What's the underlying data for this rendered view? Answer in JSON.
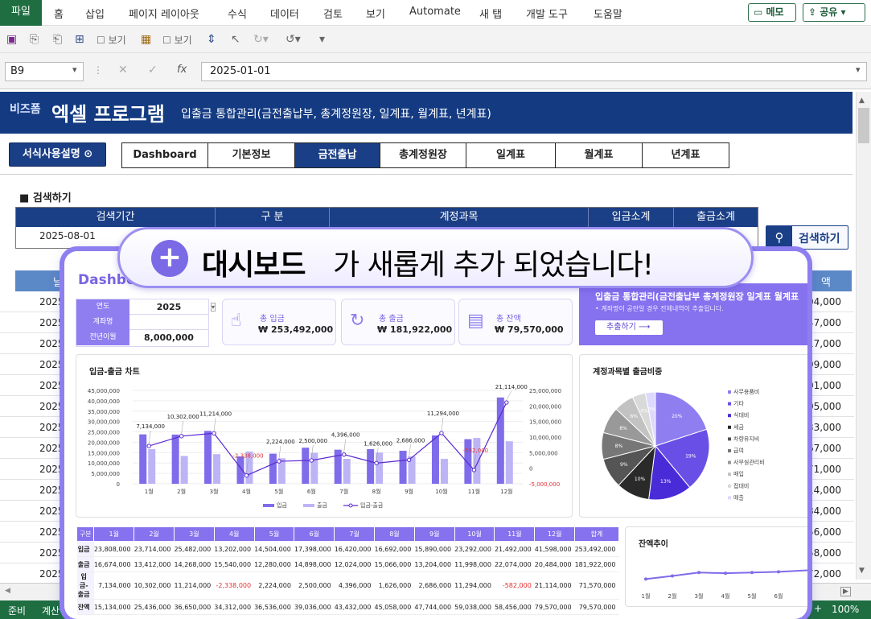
{
  "ribbon": {
    "file": "파일",
    "menus": [
      "홈",
      "삽입",
      "페이지 레이아웃",
      "수식",
      "데이터",
      "검토",
      "보기",
      "Automate",
      "새 탭",
      "개발 도구",
      "도움말"
    ],
    "memo": "메모",
    "share": "공유"
  },
  "qat": {
    "view1": "보기",
    "view2": "보기"
  },
  "formula": {
    "cell": "B9",
    "value": "2025-01-01",
    "fx": "fx"
  },
  "banner": {
    "brand_small": "비즈폼",
    "brand": "엑셀 프로그램",
    "subtitle": "입출금 통합관리(금전출납부, 총계정원장, 일계표, 월계표, 년계표)"
  },
  "guide_button": "서식사용설명",
  "nav_tabs": [
    "Dashboard",
    "기본정보",
    "금전출납",
    "총계정원장",
    "일계표",
    "월계표",
    "년계표"
  ],
  "nav_active": 2,
  "search": {
    "section": "검색하기",
    "period_label": "검색기간",
    "category_label": "구 분",
    "account_label": "계정과목",
    "income_label": "입금소계",
    "expense_label": "출금소계",
    "period_value": "2025-08-01",
    "button": "검색하기"
  },
  "ledger": {
    "date_header": "날",
    "amount_header": "액",
    "dates": [
      "2025",
      "2025",
      "2025",
      "2025",
      "2025",
      "2025",
      "2025",
      "2025",
      "2025",
      "2025",
      "2025",
      "2025",
      "2025",
      "2025",
      "2025",
      "2025",
      "2025",
      "2025",
      "2025",
      "2025"
    ],
    "amounts": [
      "04,000",
      "47,000",
      "17,000",
      "99,000",
      "01,000",
      "05,000",
      "33,000",
      "67,000",
      "71,000",
      "14,000",
      "84,000",
      "56,000",
      "58,000",
      "72,000"
    ]
  },
  "status": {
    "ready": "준비",
    "calc": "계산",
    "zoom": "100%",
    "plus": "+"
  },
  "promo_pill": {
    "bold": "대시보드",
    "rest": "가 새롭게 추가 되었습니다!"
  },
  "dashboard": {
    "title": "Dashboard",
    "year_label": "연도",
    "year_value": "2025",
    "account_label": "계좌명",
    "account_value": "",
    "carry_label": "전년이월",
    "carry_value": "8,000,000",
    "kpis": [
      {
        "label": "총 입금",
        "value": "₩ 253,492,000",
        "icon": "hand-coin-icon"
      },
      {
        "label": "총 출금",
        "value": "₩ 181,922,000",
        "icon": "coin-out-icon"
      },
      {
        "label": "총 잔액",
        "value": "₩ 79,570,000",
        "icon": "calculator-icon"
      }
    ],
    "promo": {
      "title": "입출금 통합관리(금전출납부 총계정원장 일계표 월계표",
      "sub": "• 계좌명이 공란일 경우 전체내역이 추출됩니다.",
      "button": "추출하기 ⟶"
    },
    "chart1_title": "입금-출금 차트",
    "chart2_title": "계정과목별 출금비중",
    "chart3_title": "잔액추이",
    "table": {
      "header": [
        "구분",
        "1월",
        "2월",
        "3월",
        "4월",
        "5월",
        "6월",
        "7월",
        "8월",
        "9월",
        "10월",
        "11월",
        "12월",
        "합계"
      ],
      "rows": [
        [
          "입금",
          "23,808,000",
          "23,714,000",
          "25,482,000",
          "13,202,000",
          "14,504,000",
          "17,398,000",
          "16,420,000",
          "16,692,000",
          "15,890,000",
          "23,292,000",
          "21,492,000",
          "41,598,000",
          "253,492,000"
        ],
        [
          "출금",
          "16,674,000",
          "13,412,000",
          "14,268,000",
          "15,540,000",
          "12,280,000",
          "14,898,000",
          "12,024,000",
          "15,066,000",
          "13,204,000",
          "11,998,000",
          "22,074,000",
          "20,484,000",
          "181,922,000"
        ],
        [
          "입금-출금",
          "7,134,000",
          "10,302,000",
          "11,214,000",
          "-2,338,000",
          "2,224,000",
          "2,500,000",
          "4,396,000",
          "1,626,000",
          "2,686,000",
          "11,294,000",
          "-582,000",
          "21,114,000",
          "71,570,000"
        ],
        [
          "잔액",
          "15,134,000",
          "25,436,000",
          "36,650,000",
          "34,312,000",
          "36,536,000",
          "39,036,000",
          "43,432,000",
          "45,058,000",
          "47,744,000",
          "59,038,000",
          "58,456,000",
          "79,570,000",
          "79,570,000"
        ]
      ]
    }
  },
  "chart_data": [
    {
      "type": "bar",
      "title": "입금-출금 차트",
      "categories": [
        "1월",
        "2월",
        "3월",
        "4월",
        "5월",
        "6월",
        "7월",
        "8월",
        "9월",
        "10월",
        "11월",
        "12월"
      ],
      "series": [
        {
          "name": "입금",
          "values": [
            23808000,
            23714000,
            25482000,
            13202000,
            14504000,
            17398000,
            16420000,
            16692000,
            15890000,
            23292000,
            21492000,
            41598000
          ],
          "color": "#7e6cea"
        },
        {
          "name": "출금",
          "values": [
            16674000,
            13412000,
            14268000,
            15540000,
            12280000,
            14898000,
            12024000,
            15066000,
            13204000,
            11998000,
            22074000,
            20484000
          ],
          "color": "#bdb4f5"
        },
        {
          "name": "입금-출금",
          "values": [
            7134000,
            10302000,
            11214000,
            -2338000,
            2224000,
            2500000,
            4396000,
            1626000,
            2686000,
            11294000,
            -582000,
            21114000
          ],
          "color": "#5b2ad0"
        }
      ],
      "left_ticks": [
        "0",
        "5,000,000",
        "10,000,000",
        "15,000,000",
        "20,000,000",
        "25,000,000",
        "30,000,000",
        "35,000,000",
        "40,000,000",
        "45,000,000"
      ],
      "right_ticks": [
        "-5,000,000",
        "0",
        "5,000,000",
        "10,000,000",
        "15,000,000",
        "20,000,000",
        "25,000,000"
      ],
      "labels": [
        "7,134,000",
        "10,302,000",
        "11,214,000",
        "-2,338,000",
        "2,224,000",
        "2,500,000",
        "4,396,000",
        "1,626,000",
        "2,686,000",
        "11,294,000",
        "-582,000",
        "21,114,000"
      ],
      "ylim": [
        0,
        45000000
      ],
      "y2lim": [
        -5000000,
        25000000
      ]
    },
    {
      "type": "pie",
      "title": "계정과목별 출금비중",
      "legend": [
        "사무용품비",
        "기타",
        "식대비",
        "세금",
        "차량유지비",
        "급여",
        "사무실관리비",
        "매입",
        "접대비",
        "매출"
      ],
      "values": [
        20,
        19,
        13,
        10,
        9,
        8,
        8,
        6,
        4,
        3
      ],
      "slice_labels": [
        "20%",
        "19%",
        "13%",
        "10%",
        "9%",
        "8%",
        "8%",
        "6%",
        "4%",
        "3%"
      ],
      "colors": [
        "#8e7ef0",
        "#6a4fe6",
        "#4a2bd8",
        "#2a2a2a",
        "#555555",
        "#777777",
        "#999999",
        "#c2c2c2",
        "#d9d9d9",
        "#ddd8ff"
      ]
    },
    {
      "type": "line",
      "title": "잔액추이",
      "categories": [
        "1월",
        "2월",
        "3월",
        "4월",
        "5월",
        "6월"
      ],
      "values": [
        15134000,
        25436000,
        36650000,
        34312000,
        36536000,
        39036000
      ],
      "color": "#7e6cea"
    }
  ]
}
